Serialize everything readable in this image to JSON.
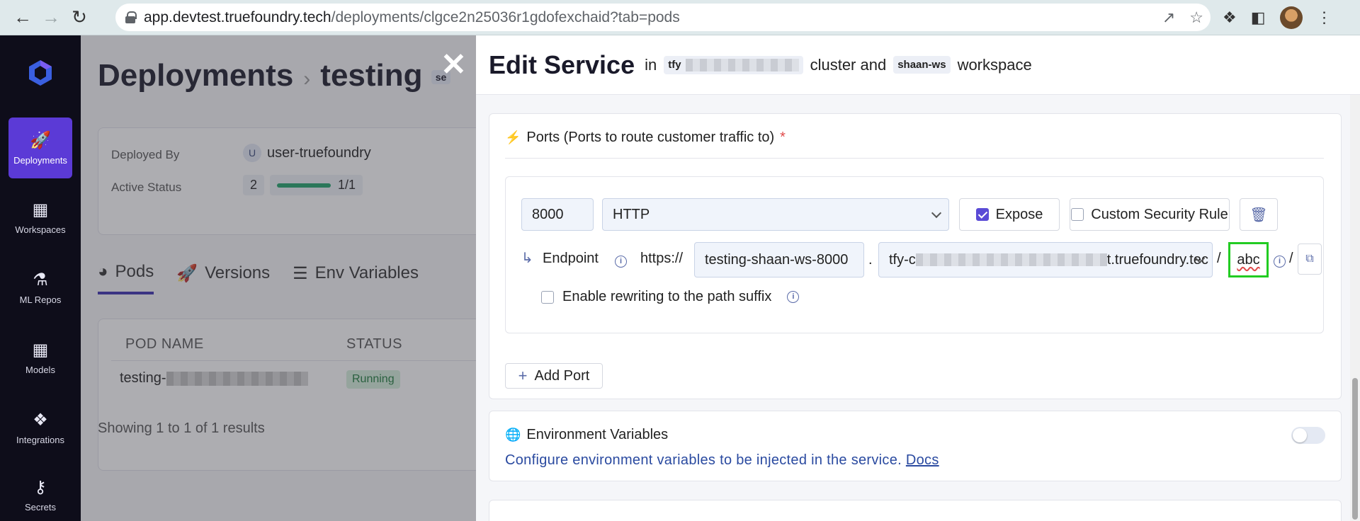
{
  "browser": {
    "url_host": "app.devtest.truefoundry.tech",
    "url_path": "/deployments/clgce2n25036r1gdofexchaid?tab=pods"
  },
  "sidebar": {
    "items": [
      {
        "label": "Deployments",
        "icon": "rocket-icon",
        "active": true
      },
      {
        "label": "Workspaces",
        "icon": "workspaces-icon"
      },
      {
        "label": "ML Repos",
        "icon": "flask-icon"
      },
      {
        "label": "Models",
        "icon": "grid-icon"
      },
      {
        "label": "Integrations",
        "icon": "puzzle-icon"
      },
      {
        "label": "Secrets",
        "icon": "key-icon"
      }
    ]
  },
  "background": {
    "title": "Deployments",
    "subtitle": "testing",
    "chip": "se",
    "deployed_by_label": "Deployed By",
    "deployed_by_initial": "U",
    "deployed_by_value": "user-truefoundry",
    "active_status_label": "Active Status",
    "active_count": "2",
    "active_ratio": "1/1",
    "tabs": [
      "Pods",
      "Versions",
      "Env Variables"
    ],
    "columns": [
      "POD NAME",
      "STATUS"
    ],
    "pod_prefix": "testing-",
    "pod_status": "Running",
    "footer": "Showing 1 to 1 of 1 results"
  },
  "drawer": {
    "title": "Edit Service",
    "in_text": "in",
    "cluster_tag": "tfy",
    "cluster_text": "cluster and",
    "workspace_tag": "shaan-ws",
    "workspace_text": "workspace",
    "ports": {
      "title": "Ports (Ports to route customer traffic to)",
      "required_mark": "*",
      "port_value": "8000",
      "protocol": "HTTP",
      "expose_label": "Expose",
      "expose_checked": true,
      "custom_rule_label": "Custom Security Rule",
      "custom_rule_checked": false,
      "endpoint_label": "Endpoint",
      "scheme": "https://",
      "host_prefix": "testing-shaan-ws-8000",
      "dot": ".",
      "domain_prefix": "tfy-c",
      "domain_suffix": "t.truefoundry.tec",
      "slash": "/",
      "path_value": "abc",
      "rewrite_label": "Enable rewriting to the path suffix",
      "rewrite_checked": false,
      "add_port_label": "Add Port"
    },
    "env": {
      "title": "Environment Variables",
      "description": "Configure environment variables to be injected in the service.",
      "docs_link": "Docs",
      "enabled": false
    }
  },
  "colors": {
    "accent": "#5a4bd6",
    "highlight": "#22cc22",
    "sidebar_bg": "#0e0d1a"
  }
}
